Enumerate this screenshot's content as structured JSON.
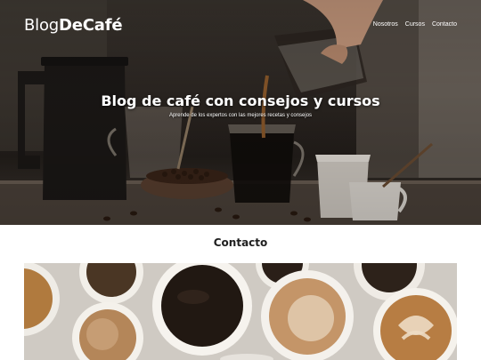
{
  "site": {
    "logo_part1": "Blog",
    "logo_part2": "DeCafé"
  },
  "nav": {
    "items": [
      {
        "label": "Nosotros"
      },
      {
        "label": "Cursos"
      },
      {
        "label": "Contacto"
      }
    ]
  },
  "hero": {
    "title": "Blog de café con consejos y cursos",
    "subtitle": "Aprende de los expertos con las mejores recetas y consejos"
  },
  "content": {
    "section_title": "Contacto"
  }
}
